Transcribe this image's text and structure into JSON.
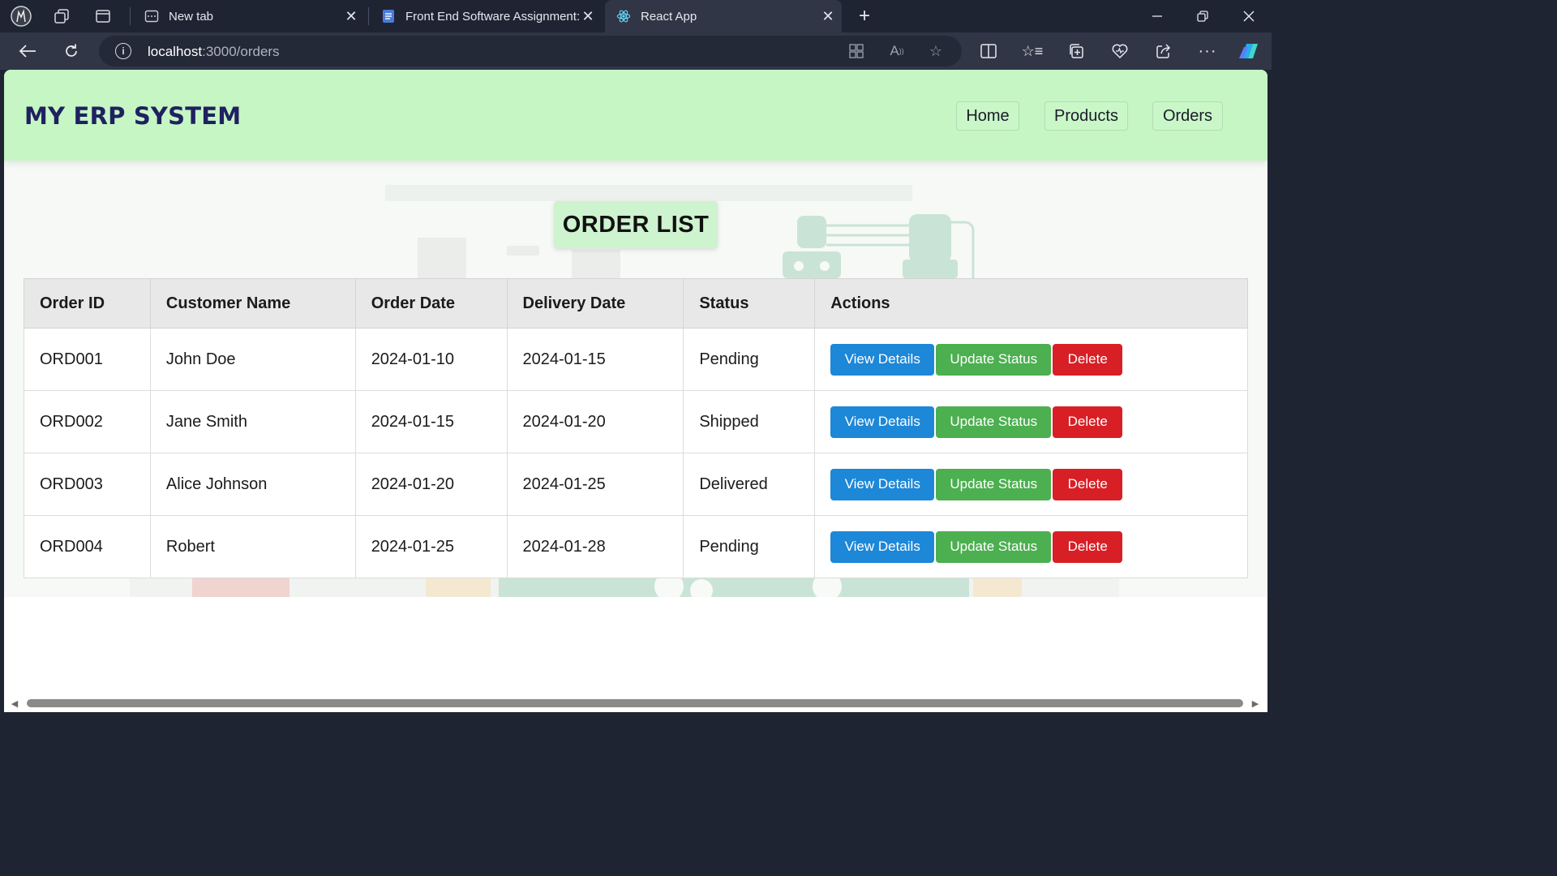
{
  "browser": {
    "tabs": [
      {
        "title": "New tab",
        "icon": "new-tab-page-icon",
        "active": false
      },
      {
        "title": "Front End Software Assignment:",
        "icon": "docs-icon",
        "active": false
      },
      {
        "title": "React App",
        "icon": "react-icon",
        "active": true
      }
    ],
    "url_host": "localhost",
    "url_path": ":3000/orders"
  },
  "header": {
    "brand": "MY ERP SYSTEM",
    "nav": [
      "Home",
      "Products",
      "Orders"
    ]
  },
  "page": {
    "title": "ORDER LIST"
  },
  "table": {
    "columns": [
      "Order ID",
      "Customer Name",
      "Order Date",
      "Delivery Date",
      "Status",
      "Actions"
    ],
    "rows": [
      {
        "id": "ORD001",
        "customer": "John Doe",
        "order_date": "2024-01-10",
        "delivery_date": "2024-01-15",
        "status": "Pending"
      },
      {
        "id": "ORD002",
        "customer": "Jane Smith",
        "order_date": "2024-01-15",
        "delivery_date": "2024-01-20",
        "status": "Shipped"
      },
      {
        "id": "ORD003",
        "customer": "Alice Johnson",
        "order_date": "2024-01-20",
        "delivery_date": "2024-01-25",
        "status": "Delivered"
      },
      {
        "id": "ORD004",
        "customer": "Robert",
        "order_date": "2024-01-25",
        "delivery_date": "2024-01-28",
        "status": "Pending"
      }
    ],
    "actions": {
      "view": "View Details",
      "update": "Update Status",
      "delete": "Delete"
    }
  },
  "colors": {
    "header_bg": "#c5f6c4",
    "brand_text": "#1f2160",
    "view_button": "#1d87d8",
    "update_button": "#4caf50",
    "delete_button": "#d81f26"
  }
}
